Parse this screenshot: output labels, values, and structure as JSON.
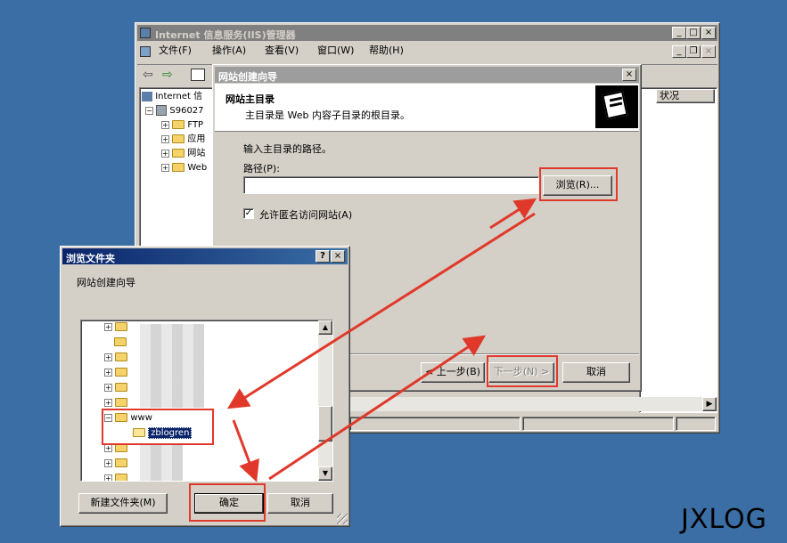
{
  "iis": {
    "title": "Internet 信息服务(IIS)管理器",
    "menu": [
      "文件(F)",
      "操作(A)",
      "查看(V)",
      "窗口(W)",
      "帮助(H)"
    ],
    "tree": [
      "Internet 信",
      "S96027",
      "FTP",
      "应用",
      "网站",
      "Web"
    ],
    "column_status": "状况"
  },
  "wizard": {
    "title": "网站创建向导",
    "header_title": "网站主目录",
    "header_sub": "主目录是 Web 内容子目录的根目录。",
    "prompt": "输入主目录的路径。",
    "path_label": "路径(P):",
    "path_value": "",
    "browse_label": "浏览(R)...",
    "anon_label": "允许匿名访问网站(A)",
    "back_label": "< 上一步(B)",
    "next_label": "下一步(N) >",
    "cancel_label": "取消"
  },
  "browse": {
    "title": "浏览文件夹",
    "help_label": "?",
    "subtitle": "网站创建向导",
    "folder_www": "www",
    "folder_selected": "zblogren",
    "new_folder_label": "新建文件夹(M)",
    "ok_label": "确定",
    "cancel_label": "取消"
  },
  "watermark": "JXLOG",
  "colors": {
    "desktop": "#3a6ea5",
    "annotation_red": "#e0392b",
    "selection": "#0a246a"
  }
}
